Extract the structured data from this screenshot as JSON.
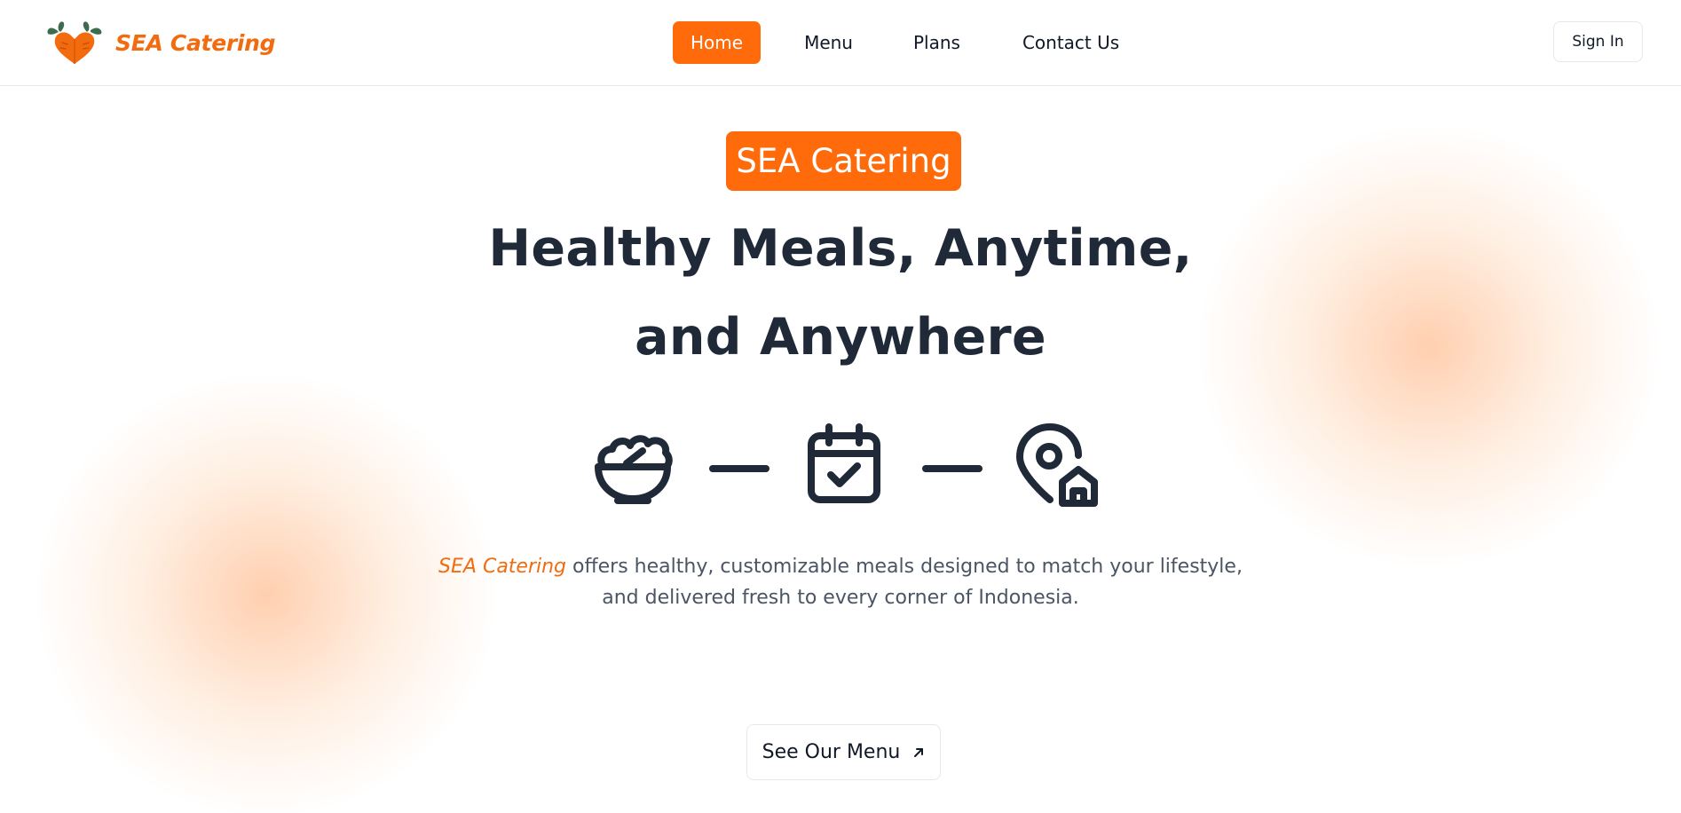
{
  "brand": {
    "name": "SEA Catering",
    "logo_icon": "carrot-heart-icon"
  },
  "nav": {
    "items": [
      {
        "label": "Home",
        "active": true
      },
      {
        "label": "Menu",
        "active": false
      },
      {
        "label": "Plans",
        "active": false
      },
      {
        "label": "Contact Us",
        "active": false
      }
    ]
  },
  "header": {
    "signin_label": "Sign In"
  },
  "hero": {
    "badge": "SEA Catering",
    "headline_line1": "Healthy Meals, Anytime,",
    "headline_line2": "and Anywhere",
    "icons": [
      "salad-bowl-icon",
      "calendar-check-icon",
      "map-pin-home-icon"
    ],
    "description_brand": "SEA Catering",
    "description_line1_rest": " offers healthy, customizable meals designed to match your lifestyle,",
    "description_line2": "and delivered fresh to every corner of Indonesia.",
    "cta_label": "See Our Menu",
    "cta_icon": "arrow-up-right-icon"
  },
  "colors": {
    "accent": "#ff6a0a",
    "brand_text": "#f26b0f",
    "heading": "#1f2937",
    "body_text": "#4b5563",
    "icon": "#1f2937"
  }
}
